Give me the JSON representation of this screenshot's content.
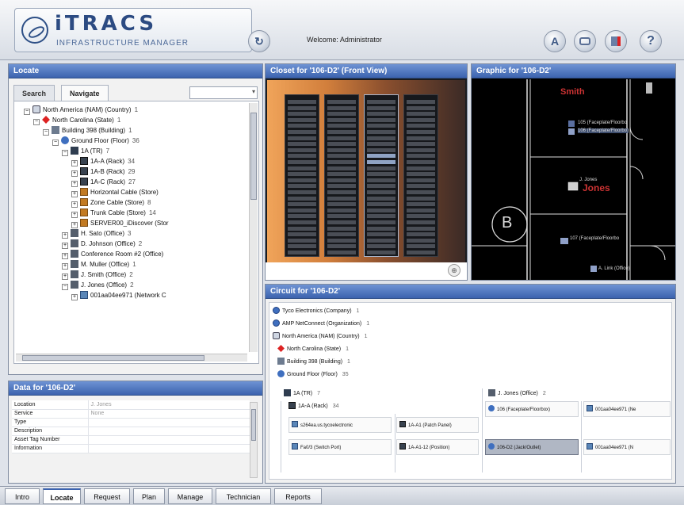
{
  "header": {
    "logo_title": "iTRACS",
    "logo_subtitle": "INFRASTRUCTURE MANAGER",
    "welcome": "Welcome: Administrator",
    "buttons": {
      "refresh_icon": "↻",
      "a_label": "A",
      "help_label": "?"
    }
  },
  "locate": {
    "title": "Locate",
    "tabs": [
      "Search",
      "Navigate"
    ],
    "active_tab": "Navigate",
    "tree": [
      {
        "indent": 1,
        "exp": "−",
        "icon": "country",
        "label": "North America (NAM) (Country)",
        "count": "1"
      },
      {
        "indent": 2,
        "exp": "−",
        "icon": "state",
        "label": "North Carolina (State)",
        "count": "1"
      },
      {
        "indent": 3,
        "exp": "−",
        "icon": "building",
        "label": "Building 398 (Building)",
        "count": "1"
      },
      {
        "indent": 4,
        "exp": "−",
        "icon": "floor",
        "label": "Ground Floor (Floor)",
        "count": "36"
      },
      {
        "indent": 5,
        "exp": "−",
        "icon": "tr",
        "label": "1A (TR)",
        "count": "7"
      },
      {
        "indent": 6,
        "exp": "+",
        "icon": "rack",
        "label": "1A-A (Rack)",
        "count": "34"
      },
      {
        "indent": 6,
        "exp": "+",
        "icon": "rack",
        "label": "1A-B (Rack)",
        "count": "29"
      },
      {
        "indent": 6,
        "exp": "+",
        "icon": "rack",
        "label": "1A-C (Rack)",
        "count": "27"
      },
      {
        "indent": 6,
        "exp": "+",
        "icon": "store",
        "label": "Horizontal Cable (Store)",
        "count": ""
      },
      {
        "indent": 6,
        "exp": "+",
        "icon": "store",
        "label": "Zone Cable (Store)",
        "count": "8"
      },
      {
        "indent": 6,
        "exp": "+",
        "icon": "store",
        "label": "Trunk Cable (Store)",
        "count": "14"
      },
      {
        "indent": 6,
        "exp": "+",
        "icon": "store",
        "label": "SERVER00_iDiscover (Stor",
        "count": ""
      },
      {
        "indent": 5,
        "exp": "+",
        "icon": "office",
        "label": "H. Sato (Office)",
        "count": "3"
      },
      {
        "indent": 5,
        "exp": "+",
        "icon": "office",
        "label": "D. Johnson (Office)",
        "count": "2"
      },
      {
        "indent": 5,
        "exp": "+",
        "icon": "office",
        "label": "Conference Room #2 (Office)",
        "count": ""
      },
      {
        "indent": 5,
        "exp": "+",
        "icon": "office",
        "label": "M. Muller (Office)",
        "count": "1"
      },
      {
        "indent": 5,
        "exp": "+",
        "icon": "office",
        "label": "J. Smith (Office)",
        "count": "2"
      },
      {
        "indent": 5,
        "exp": "−",
        "icon": "office",
        "label": "J. Jones (Office)",
        "count": "2"
      },
      {
        "indent": 6,
        "exp": "+",
        "icon": "network",
        "label": "001aa04ee971 (Network C",
        "count": ""
      }
    ]
  },
  "data_panel": {
    "title": "Data for '106-D2'",
    "rows": [
      {
        "key": "Location",
        "value": "J. Jones"
      },
      {
        "key": "Service",
        "value": "None"
      },
      {
        "key": "Type",
        "value": ""
      },
      {
        "key": "Description",
        "value": ""
      },
      {
        "key": "Asset Tag Number",
        "value": ""
      },
      {
        "key": "Information",
        "value": ""
      }
    ]
  },
  "closet": {
    "title": "Closet for '106-D2' (Front View)"
  },
  "graphic": {
    "title": "Graphic for '106-D2'",
    "labels": {
      "smith": "Smith",
      "faceplate_a": "105 (Faceplate/Floorbo",
      "faceplate_b": "106 (Faceplate/Floorbo)",
      "jones": "Jones",
      "jjones_small": "J. Jones",
      "room_b": "B",
      "faceplate_107": "107 (Faceplate/Floorbo",
      "alink": "A. Link (Office)"
    }
  },
  "circuit": {
    "title": "Circuit for '106-D2'",
    "hierarchy": [
      {
        "icon": "org",
        "label": "Tyco Electronics (Company)",
        "count": "1"
      },
      {
        "icon": "org",
        "label": "AMP NetConnect (Organization)",
        "count": "1"
      },
      {
        "icon": "country",
        "label": "North America (NAM) (Country)",
        "count": "1"
      },
      {
        "icon": "state",
        "label": "North Carolina (State)",
        "count": "1"
      },
      {
        "icon": "building",
        "label": "Building 398 (Building)",
        "count": "1"
      },
      {
        "icon": "floor",
        "label": "Ground Floor (Floor)",
        "count": "35"
      }
    ],
    "tr": {
      "label": "1A (TR)",
      "count": "7"
    },
    "office": {
      "label": "J. Jones (Office)",
      "count": "2"
    },
    "rack": {
      "label": "1A-A (Rack)",
      "count": "34"
    },
    "boxes": {
      "switch": "s264ea.us.tycoelectronic",
      "patch_panel": "1A-A1 (Patch Panel)",
      "faceplate": "106 (Faceplate/Floorbox)",
      "network": "001aa04ee971 (Ne",
      "switch_port": "Fa0/3 (Switch Port)",
      "position": "1A-A1-12 (Position)",
      "jack": "106-D2 (Jack/Outlet)",
      "network_port": "001aa04ee971 (N"
    }
  },
  "bottom_tabs": [
    "Intro",
    "Locate",
    "Request",
    "Plan",
    "Manage",
    "Technician",
    "Reports"
  ],
  "active_bottom_tab": "Locate",
  "colors": {
    "title_bar": "#3c63ae",
    "brand": "#2c4b82"
  }
}
